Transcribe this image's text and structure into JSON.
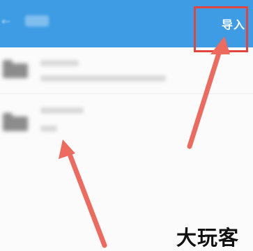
{
  "header": {
    "import_label": "导入",
    "accent_color": "#3d9ce4"
  },
  "annotations": {
    "highlight_color": "#e0463f",
    "arrow_color": "#ec6a5e"
  },
  "watermark": {
    "text": "大玩客"
  }
}
